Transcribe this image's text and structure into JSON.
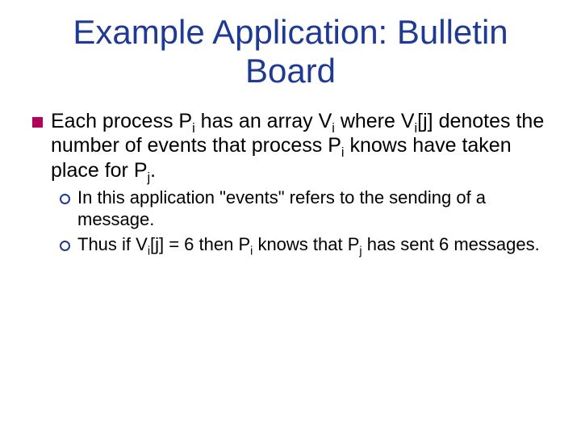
{
  "title": "Example Application: Bulletin Board",
  "bullets": {
    "main_pre": "Each process P",
    "main_sub1": "i",
    "main_mid1": " has an array V",
    "main_sub2": "i",
    "main_mid2": " where V",
    "main_sub3": "i",
    "main_mid3": "[j] denotes the number of events that process P",
    "main_sub4": "i",
    "main_mid4": " knows have taken place for P",
    "main_sub5": "j",
    "main_end": ".",
    "sub1": "In this application \"events\" refers to the sending of a message.",
    "sub2_pre": "Thus if V",
    "sub2_sub1": "i",
    "sub2_mid1": "[j] = 6 then P",
    "sub2_sub2": "i",
    "sub2_mid2": " knows that P",
    "sub2_sub3": "j",
    "sub2_end": " has sent 6 messages."
  }
}
